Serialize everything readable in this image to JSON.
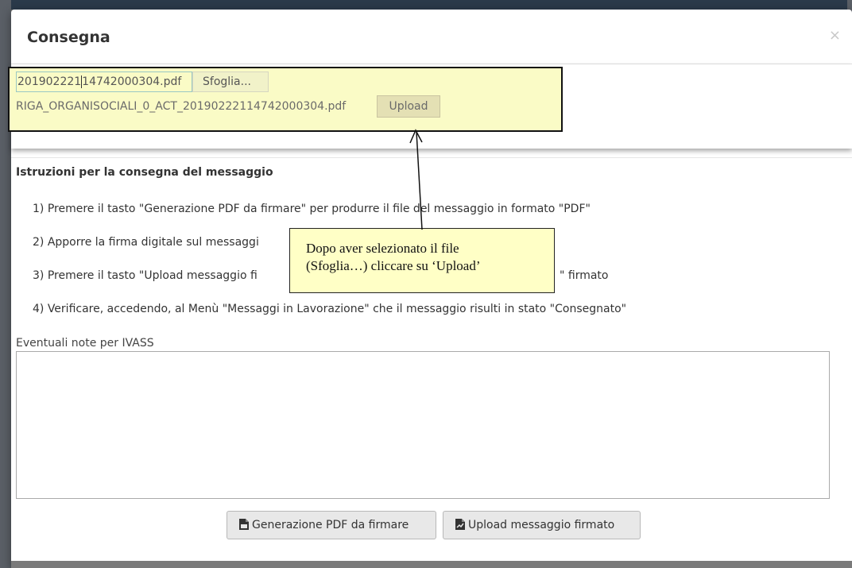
{
  "dialog": {
    "title": "Consegna",
    "close_glyph": "×"
  },
  "file_upload": {
    "file_input_value_before_caret": "201902221",
    "file_input_value_after_caret": "14742000304.pdf",
    "browse_label": "Sfoglia...",
    "selected_file_name": "RIGA_ORGANISOCIALI_0_ACT_20190222114742000304.pdf",
    "upload_label": "Upload"
  },
  "instructions": {
    "heading": "Istruzioni per la consegna del messaggio",
    "steps": [
      "1) Premere il tasto \"Generazione PDF da firmare\" per produrre il file del messaggio in formato \"PDF\"",
      "2) Apporre la firma digitale sul messaggi",
      "3) Premere il tasto \"Upload messaggio fi",
      "\" firmato",
      "4) Verificare, accedendo, al Menù \"Messaggi in Lavorazione\" che il messaggio risulti in stato \"Consegnato\""
    ]
  },
  "callout_note": {
    "line1": "Dopo aver selezionato il file",
    "line2": "(Sfoglia…) cliccare su ‘Upload’"
  },
  "notes": {
    "label": "Eventuali note per IVASS",
    "value": ""
  },
  "actions": {
    "generate_pdf_label": "Generazione PDF da firmare",
    "upload_signed_label": "Upload messaggio firmato",
    "generate_pdf_icon": "pdf-file-icon",
    "upload_signed_icon": "signed-file-icon"
  },
  "colors": {
    "callout_fill": "#fafbc6",
    "note_fill": "#ffffc6",
    "button_fill": "#e8e8e8"
  }
}
